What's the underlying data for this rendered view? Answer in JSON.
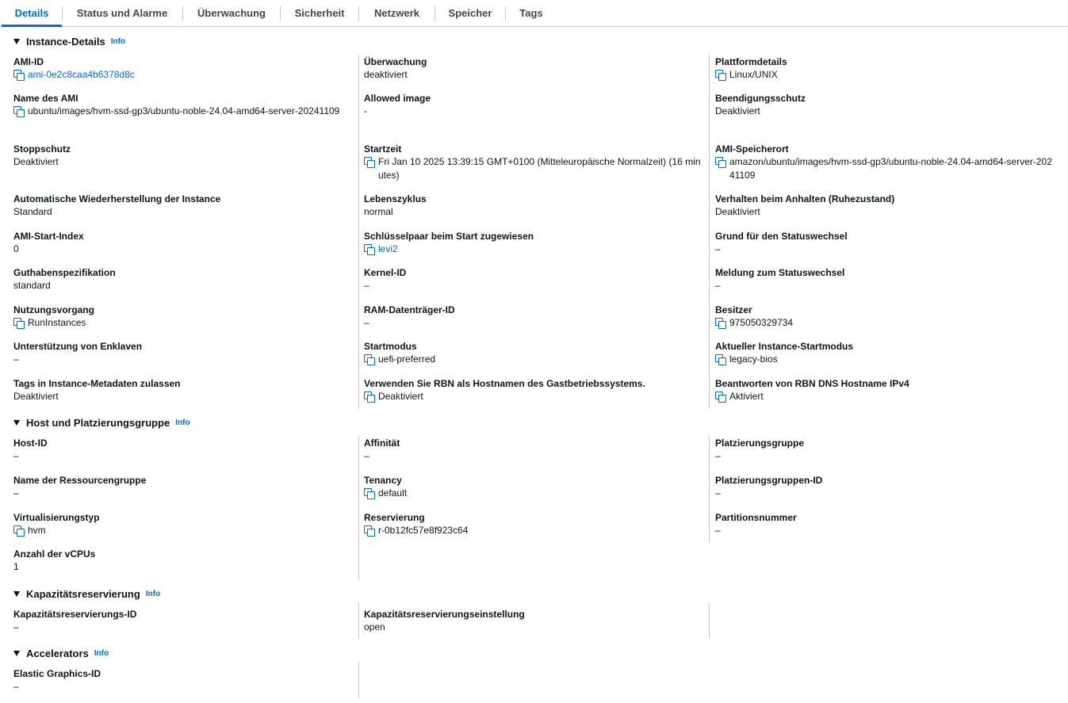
{
  "tabs": [
    "Details",
    "Status und Alarme",
    "Überwachung",
    "Sicherheit",
    "Netzwerk",
    "Speicher",
    "Tags"
  ],
  "info_label": "Info",
  "sections": {
    "instance": {
      "title": "Instance-Details",
      "col1": [
        {
          "label": "AMI-ID",
          "value": "ami-0e2c8caa4b6378d8c",
          "copy": true,
          "link": true
        },
        {
          "label": "Name des AMI",
          "value": "ubuntu/images/hvm-ssd-gp3/ubuntu-noble-24.04-amd64-server-20241109",
          "copy": true
        },
        {
          "label": "Stoppschutz",
          "value": "Deaktiviert"
        },
        {
          "label": "Automatische Wiederherstellung der Instance",
          "value": "Standard"
        },
        {
          "label": "AMI-Start-Index",
          "value": "0"
        },
        {
          "label": "Guthabenspezifikation",
          "value": "standard"
        },
        {
          "label": "Nutzungsvorgang",
          "value": "RunInstances",
          "copy": true
        },
        {
          "label": "Unterstützung von Enklaven",
          "value": "–"
        },
        {
          "label": "Tags in Instance-Metadaten zulassen",
          "value": "Deaktiviert"
        }
      ],
      "col2": [
        {
          "label": "Überwachung",
          "value": "deaktiviert"
        },
        {
          "label": "Allowed image",
          "value": "-"
        },
        {
          "label": "Startzeit",
          "value": "Fri Jan 10 2025 13:39:15 GMT+0100 (Mitteleuropäische Normalzeit) (16 minutes)",
          "copy": true
        },
        {
          "label": "Lebenszyklus",
          "value": "normal"
        },
        {
          "label": "Schlüsselpaar beim Start zugewiesen",
          "value": "levi2",
          "copy": true,
          "link": true
        },
        {
          "label": "Kernel-ID",
          "value": "–"
        },
        {
          "label": "RAM-Datenträger-ID",
          "value": "–"
        },
        {
          "label": "Startmodus",
          "value": "uefi-preferred",
          "copy": true
        },
        {
          "label": "Verwenden Sie RBN als Hostnamen des Gastbetriebssystems.",
          "value": "Deaktiviert",
          "copy": true
        }
      ],
      "col3": [
        {
          "label": "Plattformdetails",
          "value": "Linux/UNIX",
          "copy": true
        },
        {
          "label": "Beendigungsschutz",
          "value": "Deaktiviert"
        },
        {
          "label": "AMI-Speicherort",
          "value": "amazon/ubuntu/images/hvm-ssd-gp3/ubuntu-noble-24.04-amd64-server-20241109",
          "copy": true
        },
        {
          "label": "Verhalten beim Anhalten (Ruhezustand)",
          "value": "Deaktiviert"
        },
        {
          "label": "Grund für den Statuswechsel",
          "value": "–"
        },
        {
          "label": "Meldung zum Statuswechsel",
          "value": "–"
        },
        {
          "label": "Besitzer",
          "value": "975050329734",
          "copy": true
        },
        {
          "label": "Aktueller Instance-Startmodus",
          "value": "legacy-bios",
          "copy": true
        },
        {
          "label": "Beantworten von RBN DNS Hostname IPv4",
          "value": "Aktiviert",
          "copy": true
        }
      ]
    },
    "host": {
      "title": "Host und Platzierungsgruppe",
      "col1": [
        {
          "label": "Host-ID",
          "value": "–"
        },
        {
          "label": "Name der Ressourcengruppe",
          "value": "–"
        },
        {
          "label": "Virtualisierungstyp",
          "value": "hvm",
          "copy": true
        },
        {
          "label": "Anzahl der vCPUs",
          "value": "1"
        }
      ],
      "col2": [
        {
          "label": "Affinität",
          "value": "–"
        },
        {
          "label": "Tenancy",
          "value": "default",
          "copy": true
        },
        {
          "label": "Reservierung",
          "value": "r-0b12fc57e8f923c64",
          "copy": true
        }
      ],
      "col3": [
        {
          "label": "Platzierungsgruppe",
          "value": "–"
        },
        {
          "label": "Platzierungsgruppen-ID",
          "value": "–"
        },
        {
          "label": "Partitionsnummer",
          "value": "–"
        }
      ]
    },
    "capacity": {
      "title": "Kapazitätsreservierung",
      "col1": [
        {
          "label": "Kapazitätsreservierungs-ID",
          "value": "–"
        }
      ],
      "col2": [
        {
          "label": "Kapazitätsreservierungseinstellung",
          "value": "open"
        }
      ]
    },
    "accelerators": {
      "title": "Accelerators",
      "col1": [
        {
          "label": "Elastic Graphics-ID",
          "value": "–"
        }
      ]
    }
  }
}
